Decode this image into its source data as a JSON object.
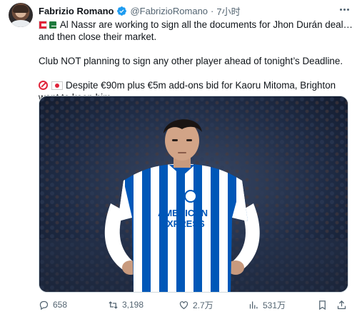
{
  "tweet": {
    "author_name": "Fabrizio Romano",
    "handle": "@FabrizioRomano",
    "separator": "·",
    "time": "7小时",
    "line1": "Al Nassr are working to sign all the documents for Jhon Durán deal…",
    "line2": "and then close their market.",
    "line3": "Club NOT planning to sign any other player ahead of tonight’s Deadline.",
    "line4": "Despite €90m plus €5m add-ons bid for Kaoru Mitoma, Brighton",
    "line5": "want to keep him.",
    "media_alt_text": "AMERICAN EXPRESS",
    "icons": {
      "verified": "verified-badge-icon",
      "more": "more-options-icon",
      "flag1": "arsenal-flag-emoji",
      "flag2": "saudi-flag-emoji",
      "no_entry": "no-entry-emoji",
      "japan_flag": "japan-flag-emoji"
    }
  },
  "actions": {
    "replies": "658",
    "retweets": "3,198",
    "likes": "2.7万",
    "views": "531万"
  },
  "colors": {
    "text": "#0f1419",
    "muted": "#536471",
    "verified": "#1d9bf0",
    "brighton_blue": "#0057b8"
  }
}
